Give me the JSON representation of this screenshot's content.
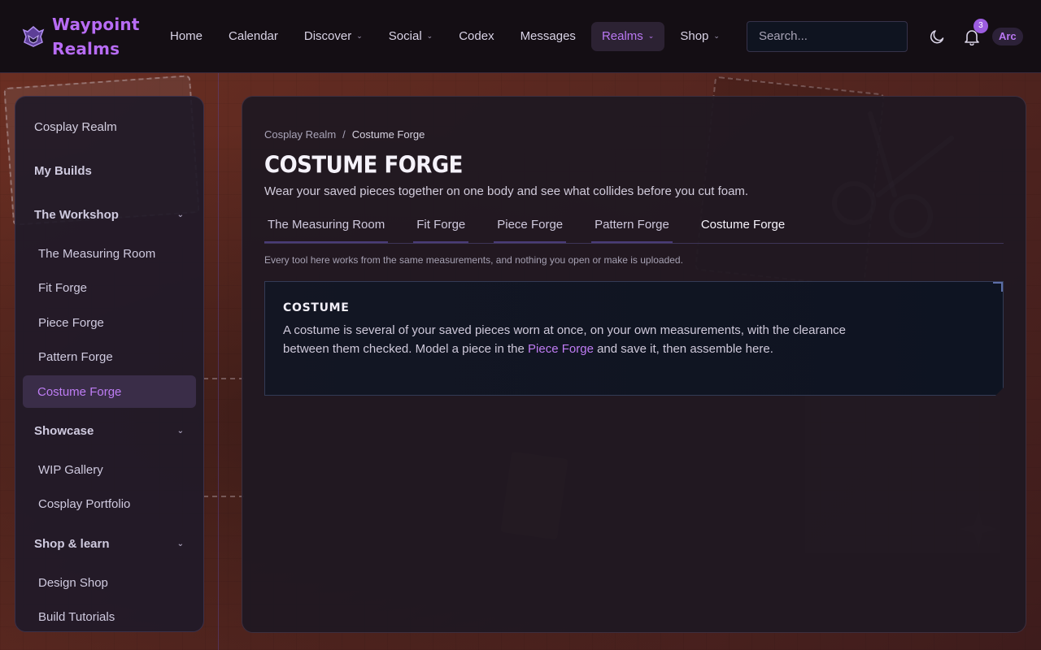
{
  "brand": {
    "name_line1": "Waypoint",
    "name_line2": "Realms"
  },
  "nav": {
    "items": [
      {
        "label": "Home",
        "has_menu": false
      },
      {
        "label": "Calendar",
        "has_menu": false
      },
      {
        "label": "Discover",
        "has_menu": true
      },
      {
        "label": "Social",
        "has_menu": true
      },
      {
        "label": "Codex",
        "has_menu": false
      },
      {
        "label": "Messages",
        "has_menu": false
      },
      {
        "label": "Realms",
        "has_menu": true,
        "active": true
      },
      {
        "label": "Shop",
        "has_menu": true
      }
    ],
    "search_placeholder": "Search...",
    "notification_count": "3",
    "user_chip": "Arc"
  },
  "sidebar": {
    "top_link": "Cosplay Realm",
    "my_builds": "My Builds",
    "sections": [
      {
        "title": "The Workshop",
        "items": [
          "The Measuring Room",
          "Fit Forge",
          "Piece Forge",
          "Pattern Forge",
          "Costume Forge"
        ]
      },
      {
        "title": "Showcase",
        "items": [
          "WIP Gallery",
          "Cosplay Portfolio"
        ]
      },
      {
        "title": "Shop & learn",
        "items": [
          "Design Shop",
          "Build Tutorials"
        ]
      }
    ]
  },
  "main": {
    "breadcrumb": {
      "parent": "Cosplay Realm",
      "separator": "/",
      "current": "Costume Forge"
    },
    "title": "COSTUME FORGE",
    "subtitle": "Wear your saved pieces together on one body and see what collides before you cut foam.",
    "tabs": [
      "The Measuring Room",
      "Fit Forge",
      "Piece Forge",
      "Pattern Forge",
      "Costume Forge"
    ],
    "active_tab": "Costume Forge",
    "note": "Every tool here works from the same measurements, and nothing you open or make is uploaded.",
    "card": {
      "title": "COSTUME",
      "body_before": "A costume is several of your saved pieces worn at once, on your own measurements, with the clearance between them checked. Model a piece in the ",
      "link": "Piece Forge",
      "body_after": " and save it, then assemble here."
    }
  },
  "colors": {
    "accent": "#b86cf5",
    "topbar_bg": "#140e14",
    "panel_bg": "#201822",
    "background_leather": "#5a2820"
  }
}
